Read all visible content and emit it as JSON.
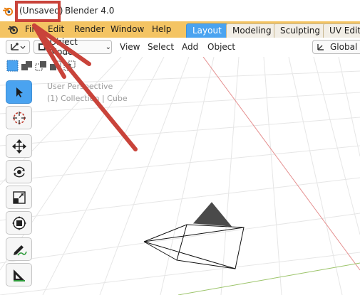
{
  "window": {
    "unsaved_label": "(Unsaved)",
    "app_title": "Blender 4.0"
  },
  "menubar": {
    "items": [
      "File",
      "Edit",
      "Render",
      "Window",
      "Help"
    ]
  },
  "workspace_tabs": [
    {
      "label": "Layout",
      "active": true
    },
    {
      "label": "Modeling",
      "active": false
    },
    {
      "label": "Sculpting",
      "active": false
    },
    {
      "label": "UV Editi",
      "active": false
    }
  ],
  "header": {
    "mode_label": "Object Mode",
    "menus": [
      "View",
      "Select",
      "Add",
      "Object"
    ],
    "transform_orientation": "Global"
  },
  "viewport": {
    "perspective_label": "User Perspective",
    "collection_label": "(1) Collection | Cube"
  },
  "tools": [
    {
      "name": "select-tool",
      "icon": "cursor-arrow-icon",
      "active": true
    },
    {
      "name": "cursor-tool",
      "icon": "3d-cursor-icon",
      "active": false
    },
    {
      "name": "move-tool",
      "icon": "move-arrows-icon",
      "active": false
    },
    {
      "name": "rotate-tool",
      "icon": "rotate-icon",
      "active": false
    },
    {
      "name": "scale-tool",
      "icon": "scale-icon",
      "active": false
    },
    {
      "name": "transform-tool",
      "icon": "transform-icon",
      "active": false
    },
    {
      "name": "annotate-tool",
      "icon": "pencil-icon",
      "active": false
    },
    {
      "name": "measure-tool",
      "icon": "ruler-icon",
      "active": false
    }
  ],
  "colors": {
    "menubar_bg": "#f4c463",
    "active_tab": "#4aa3f0",
    "annotation_red": "#c9433a",
    "x_axis": "#e59090",
    "y_axis": "#9cc46a"
  }
}
